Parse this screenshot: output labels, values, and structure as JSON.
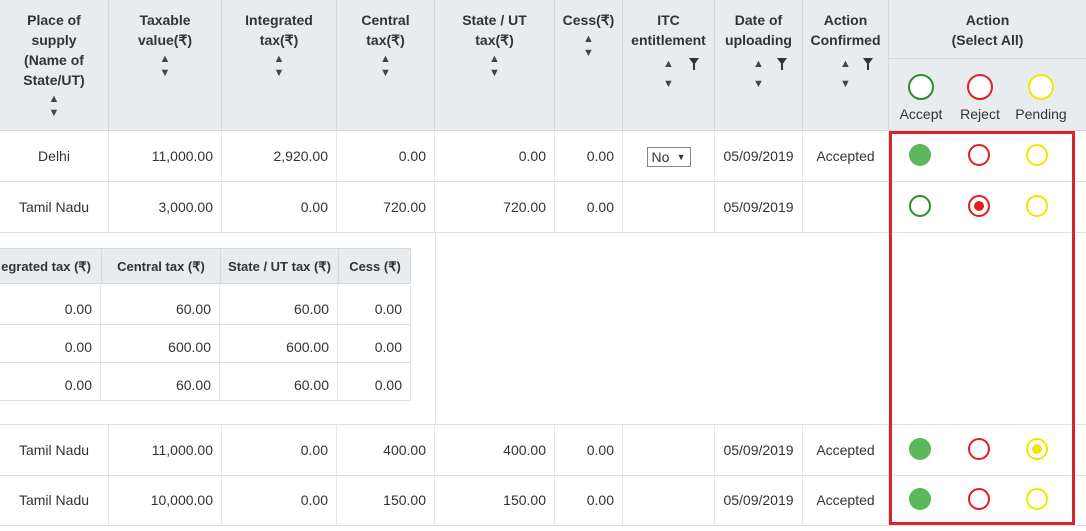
{
  "headers": {
    "place": [
      "Place of",
      "supply",
      "(Name of",
      "State/UT)"
    ],
    "taxable": [
      "Taxable",
      "value(₹)"
    ],
    "integrated": [
      "Integrated",
      "tax(₹)"
    ],
    "central": [
      "Central",
      "tax(₹)"
    ],
    "state": [
      "State / UT",
      "tax(₹)"
    ],
    "cess": [
      "Cess(₹)"
    ],
    "itc": [
      "ITC",
      "entitlement"
    ],
    "date": [
      "Date of",
      "uploading"
    ],
    "action_confirmed": [
      "Action",
      "Confirmed"
    ],
    "action": [
      "Action",
      "(Select All)"
    ],
    "options": [
      "Accept",
      "Reject",
      "Pending"
    ]
  },
  "rows": [
    {
      "place": "Delhi",
      "taxable": "11,000.00",
      "integrated": "2,920.00",
      "central": "0.00",
      "state": "0.00",
      "cess": "0.00",
      "itc": "No",
      "date": "05/09/2019",
      "confirmed": "Accepted",
      "selected": "accept"
    },
    {
      "place": "Tamil Nadu",
      "taxable": "3,000.00",
      "integrated": "0.00",
      "central": "720.00",
      "state": "720.00",
      "cess": "0.00",
      "itc": "",
      "date": "05/09/2019",
      "confirmed": "",
      "selected": "reject"
    },
    {
      "place": "Tamil Nadu",
      "taxable": "11,000.00",
      "integrated": "0.00",
      "central": "400.00",
      "state": "400.00",
      "cess": "0.00",
      "itc": "",
      "date": "05/09/2019",
      "confirmed": "Accepted",
      "selected": "pending"
    },
    {
      "place": "Tamil Nadu",
      "taxable": "10,000.00",
      "integrated": "0.00",
      "central": "150.00",
      "state": "150.00",
      "cess": "0.00",
      "itc": "",
      "date": "05/09/2019",
      "confirmed": "Accepted",
      "selected": "accept"
    }
  ],
  "subtable": {
    "headers": [
      "egrated tax (₹)",
      "Central tax (₹)",
      "State / UT tax (₹)",
      "Cess (₹)"
    ],
    "rows": [
      [
        "0.00",
        "60.00",
        "60.00",
        "0.00"
      ],
      [
        "0.00",
        "600.00",
        "600.00",
        "0.00"
      ],
      [
        "0.00",
        "60.00",
        "60.00",
        "0.00"
      ]
    ]
  },
  "colors": {
    "accept": "#5cb85c",
    "reject": "#e02020",
    "pending": "#f2e600",
    "highlight": "#d9232d"
  }
}
